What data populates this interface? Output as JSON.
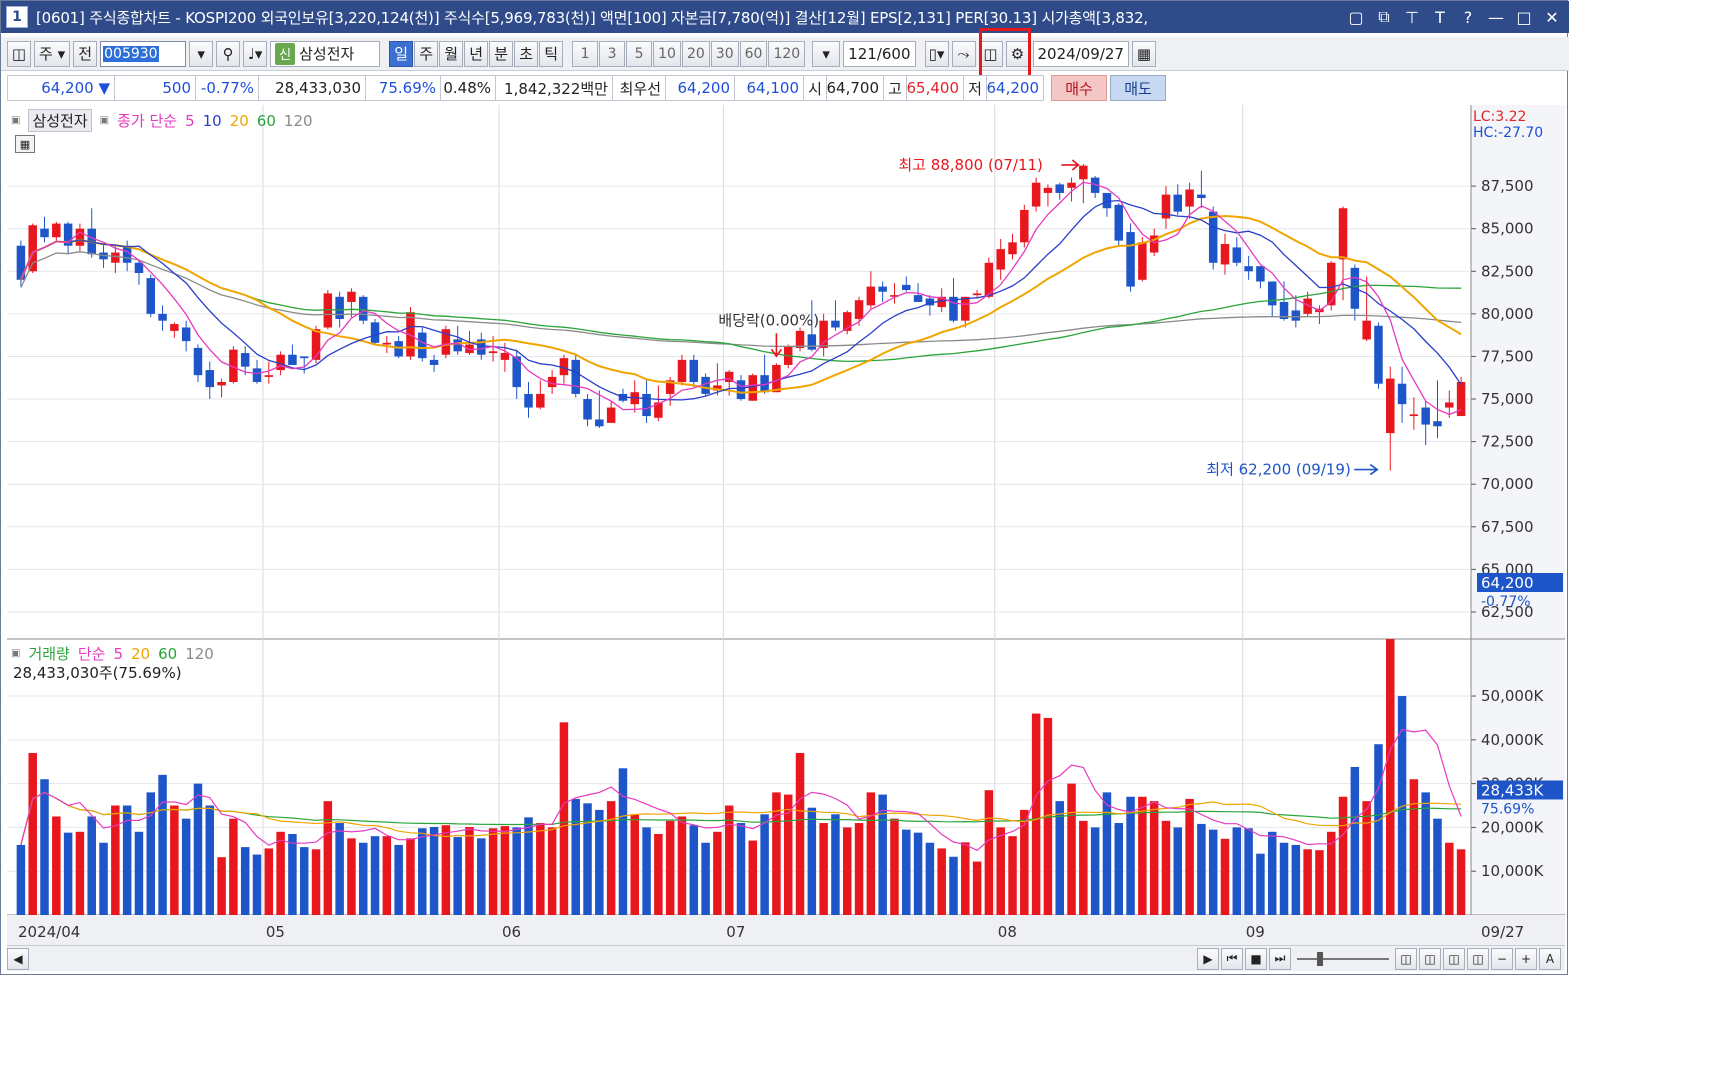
{
  "window": {
    "number": "1",
    "title": "[0601] 주식종합차트 - KOSPI200 외국인보유[3,220,124(천)] 주식수[5,969,783(천)] 액면[100] 자본금[7,780(억)] 결산[12월] EPS[2,131] PER[30.13] 시가총액[3,832,"
  },
  "toolbar": {
    "market": "주",
    "prev_label": "전",
    "code": "005930",
    "sin_badge": "신",
    "stock_name": "삼성전자",
    "periods": [
      "일",
      "주",
      "월",
      "년",
      "분",
      "초",
      "틱"
    ],
    "active_period": "일",
    "intervals": [
      "1",
      "3",
      "5",
      "10",
      "20",
      "30",
      "60",
      "120"
    ],
    "count": "121",
    "count_total": "/600",
    "date": "2024/09/27"
  },
  "quote": {
    "price": "64,200",
    "change": "500",
    "change_pct": "-0.77%",
    "volume": "28,433,030",
    "volume_ratio": "75.69%",
    "turnover": "0.48%",
    "amount": "1,842,322백만",
    "preferred_label": "최우선",
    "ask": "64,200",
    "bid": "64,100",
    "open_label": "시",
    "open": "64,700",
    "high_label": "고",
    "high": "65,400",
    "low_label": "저",
    "low": "64,200",
    "buy_label": "매수",
    "sell_label": "매도"
  },
  "price_legend": {
    "name": "삼성전자",
    "type_label": "종가 단순",
    "periods": [
      "5",
      "10",
      "20",
      "60",
      "120"
    ],
    "lc": "LC:3.22",
    "hc": "HC:-27.70"
  },
  "volume_legend": {
    "name": "거래량",
    "type_label": "단순",
    "periods": [
      "5",
      "20",
      "60",
      "120"
    ],
    "current": "28,433,030주(75.69%)"
  },
  "annotations": {
    "high": "최고 88,800 (07/11)",
    "low": "최저 62,200 (09/19)",
    "dividend": "배당락(0.00%)",
    "last_price": "64,200",
    "last_pct": "-0.77%",
    "last_volume": "28,433K",
    "last_volume_pct": "75.69%"
  },
  "colors": {
    "up": "#e8171e",
    "down": "#1e55c8",
    "ma5": "#e63ac0",
    "ma10": "#2a3fc9",
    "ma20": "#f0a500",
    "ma60": "#2aa43a",
    "ma120": "#8a8a8a"
  },
  "chart_data": {
    "type": "candlestick",
    "x_labels": [
      "2024/04",
      "05",
      "06",
      "07",
      "08",
      "09",
      "09/27"
    ],
    "price_axis": [
      "87,500",
      "85,000",
      "82,500",
      "80,000",
      "77,500",
      "75,000",
      "72,500",
      "70,000",
      "67,500",
      "65,000",
      "62,500"
    ],
    "volume_axis": [
      "50,000K",
      "40,000K",
      "30,000K",
      "20,000K",
      "10,000K"
    ],
    "price_range": [
      61500,
      90500
    ],
    "volume_range": [
      0,
      58000
    ],
    "month_start_index": {
      "04": 0,
      "05": 21,
      "06": 41,
      "07": 60,
      "08": 83,
      "09": 104
    },
    "candles": [
      [
        84000,
        82000,
        84300,
        81600,
        16000
      ],
      [
        82500,
        85200,
        85300,
        82400,
        37000
      ],
      [
        85000,
        84500,
        85700,
        84200,
        31000
      ],
      [
        84500,
        85300,
        85400,
        84200,
        22500
      ],
      [
        85300,
        84000,
        85400,
        83500,
        18800
      ],
      [
        84000,
        85000,
        85300,
        83700,
        19000
      ],
      [
        85000,
        83500,
        86200,
        83300,
        22500
      ],
      [
        83600,
        83200,
        84100,
        82700,
        16500
      ],
      [
        83000,
        83600,
        84000,
        82400,
        25000
      ],
      [
        84000,
        83000,
        84300,
        82500,
        25000
      ],
      [
        83000,
        82400,
        83200,
        81700,
        19000
      ],
      [
        82100,
        80000,
        82300,
        79800,
        28000
      ],
      [
        80000,
        79600,
        80500,
        79000,
        32000
      ],
      [
        79000,
        79400,
        79500,
        78600,
        25000
      ],
      [
        79200,
        78400,
        79600,
        77800,
        22000
      ],
      [
        78000,
        76400,
        78200,
        76000,
        30000
      ],
      [
        76700,
        75700,
        77200,
        75000,
        25000
      ],
      [
        75800,
        76000,
        76200,
        75100,
        13200
      ],
      [
        76000,
        77900,
        78100,
        75900,
        22000
      ],
      [
        77700,
        76900,
        78100,
        76400,
        15500
      ],
      [
        76800,
        76000,
        77300,
        75900,
        13800
      ],
      [
        76300,
        76400,
        77200,
        75900,
        15200
      ],
      [
        76700,
        77600,
        77800,
        76400,
        19000
      ],
      [
        77600,
        77000,
        78200,
        77000,
        18500
      ],
      [
        77500,
        77400,
        77500,
        76500,
        15500
      ],
      [
        77300,
        79100,
        79300,
        77100,
        15000
      ],
      [
        79200,
        81200,
        81400,
        79100,
        26000
      ],
      [
        81000,
        79700,
        81300,
        79200,
        21000
      ],
      [
        80700,
        81300,
        81500,
        79800,
        17500
      ],
      [
        81000,
        79600,
        81100,
        79400,
        16500
      ],
      [
        79500,
        78300,
        79700,
        78200,
        18000
      ],
      [
        78200,
        78300,
        78700,
        77700,
        18000
      ],
      [
        78400,
        77500,
        78700,
        77400,
        16000
      ],
      [
        77500,
        80100,
        80400,
        77300,
        17500
      ],
      [
        78900,
        77400,
        79200,
        77200,
        19800
      ],
      [
        77300,
        77000,
        77600,
        76600,
        20100
      ],
      [
        77600,
        79100,
        79300,
        77400,
        20500
      ],
      [
        78500,
        77800,
        79300,
        77600,
        17800
      ],
      [
        77700,
        78200,
        79000,
        77600,
        20100
      ],
      [
        78500,
        77600,
        78900,
        77300,
        17500
      ],
      [
        77700,
        77800,
        78700,
        77200,
        19800
      ],
      [
        77300,
        77700,
        78300,
        76600,
        20300
      ],
      [
        77500,
        75700,
        77900,
        75000,
        20000
      ],
      [
        75300,
        74500,
        76000,
        73900,
        22300
      ],
      [
        74500,
        75300,
        76100,
        74400,
        21000
      ],
      [
        75700,
        76300,
        76700,
        75300,
        20000
      ],
      [
        76400,
        77400,
        77600,
        75900,
        44000
      ],
      [
        77300,
        75300,
        77600,
        75100,
        26500
      ],
      [
        75000,
        73800,
        75300,
        73400,
        25500
      ],
      [
        73800,
        73400,
        75500,
        73300,
        24000
      ],
      [
        73600,
        74500,
        74900,
        73600,
        26000
      ],
      [
        75300,
        74900,
        75600,
        74800,
        33500
      ],
      [
        74700,
        75400,
        76100,
        74200,
        23000
      ],
      [
        75300,
        74000,
        76100,
        73600,
        20000
      ],
      [
        73900,
        74800,
        75800,
        73700,
        18500
      ],
      [
        75300,
        76100,
        76300,
        74600,
        21500
      ],
      [
        76000,
        77300,
        77600,
        75800,
        22500
      ],
      [
        77300,
        76000,
        77600,
        75700,
        20500
      ],
      [
        76300,
        75300,
        76500,
        75200,
        16500
      ],
      [
        75500,
        75800,
        77100,
        75200,
        19000
      ],
      [
        76000,
        76600,
        76700,
        75200,
        25000
      ],
      [
        76100,
        75000,
        76400,
        74900,
        21000
      ],
      [
        74900,
        76400,
        76500,
        74900,
        17000
      ],
      [
        76400,
        75400,
        77600,
        75300,
        23000
      ],
      [
        75400,
        77000,
        77100,
        75400,
        28000
      ],
      [
        77000,
        78100,
        78200,
        76800,
        27500
      ],
      [
        78000,
        79000,
        79200,
        77800,
        37000
      ],
      [
        78800,
        77900,
        80800,
        77800,
        24500
      ],
      [
        78000,
        79600,
        80000,
        77500,
        21000
      ],
      [
        79600,
        79200,
        80800,
        79000,
        23000
      ],
      [
        79000,
        80100,
        80200,
        78800,
        20000
      ],
      [
        79700,
        80800,
        81000,
        79300,
        21000
      ],
      [
        80500,
        81600,
        82500,
        80300,
        28000
      ],
      [
        81600,
        81300,
        81900,
        80700,
        27500
      ],
      [
        81000,
        81100,
        81800,
        80600,
        22000
      ],
      [
        81700,
        81400,
        82200,
        81300,
        19500
      ],
      [
        81100,
        80700,
        81800,
        80700,
        18800
      ],
      [
        80900,
        80500,
        81100,
        79900,
        16500
      ],
      [
        80400,
        81000,
        81500,
        80100,
        15200
      ],
      [
        81000,
        79600,
        82100,
        79500,
        13300
      ],
      [
        79600,
        81000,
        81000,
        79200,
        16600
      ],
      [
        81100,
        81200,
        81400,
        80900,
        12200
      ],
      [
        81000,
        83000,
        83300,
        80900,
        28500
      ],
      [
        82600,
        83800,
        84400,
        82000,
        20000
      ],
      [
        83500,
        84200,
        84700,
        83200,
        18000
      ],
      [
        84200,
        86100,
        86400,
        83900,
        24000
      ],
      [
        86300,
        87700,
        88000,
        86000,
        46000
      ],
      [
        87100,
        87400,
        87600,
        86300,
        45000
      ],
      [
        87600,
        87100,
        87700,
        86700,
        26000
      ],
      [
        87400,
        87700,
        88000,
        86600,
        30000
      ],
      [
        87900,
        88700,
        88800,
        86500,
        21500
      ],
      [
        88000,
        87100,
        88100,
        86800,
        20000
      ],
      [
        87100,
        86200,
        86900,
        85700,
        28000
      ],
      [
        86400,
        84300,
        86500,
        84000,
        21000
      ],
      [
        84800,
        81600,
        85300,
        81300,
        27000
      ],
      [
        82000,
        84200,
        84500,
        81900,
        27000
      ],
      [
        83600,
        84600,
        85000,
        83400,
        26000
      ],
      [
        85600,
        87000,
        87500,
        85000,
        21500
      ],
      [
        87000,
        86000,
        87600,
        85800,
        20000
      ],
      [
        86300,
        87300,
        87700,
        85600,
        26500
      ],
      [
        87000,
        86800,
        88400,
        86200,
        20800
      ],
      [
        86000,
        83000,
        86300,
        82600,
        19500
      ],
      [
        82900,
        84100,
        84700,
        82300,
        17400
      ],
      [
        83900,
        83000,
        84500,
        82800,
        20000
      ],
      [
        82800,
        82500,
        83400,
        82000,
        19800
      ],
      [
        82800,
        81900,
        82800,
        81500,
        14000
      ],
      [
        81900,
        80500,
        81900,
        79800,
        19000
      ],
      [
        80700,
        79700,
        81900,
        79600,
        16500
      ],
      [
        80200,
        79600,
        81100,
        79200,
        16000
      ],
      [
        80000,
        80900,
        81300,
        79800,
        15000
      ],
      [
        80100,
        80300,
        80500,
        79400,
        14800
      ],
      [
        80500,
        83000,
        83100,
        80200,
        19000
      ],
      [
        83200,
        86200,
        86300,
        80800,
        27000
      ],
      [
        82700,
        80300,
        82900,
        79600,
        33800
      ],
      [
        78500,
        79600,
        82200,
        78400,
        26000
      ],
      [
        79300,
        75900,
        79500,
        75600,
        39000
      ],
      [
        73000,
        76200,
        76900,
        70800,
        63000
      ],
      [
        75900,
        74700,
        76900,
        73600,
        50000
      ],
      [
        74000,
        74100,
        75100,
        73200,
        31000
      ],
      [
        74500,
        73500,
        74900,
        72300,
        28000
      ],
      [
        73700,
        73400,
        76100,
        72700,
        22000
      ],
      [
        74500,
        74800,
        75500,
        73900,
        16500
      ],
      [
        74000,
        76000,
        76300,
        74000,
        15000
      ]
    ]
  }
}
